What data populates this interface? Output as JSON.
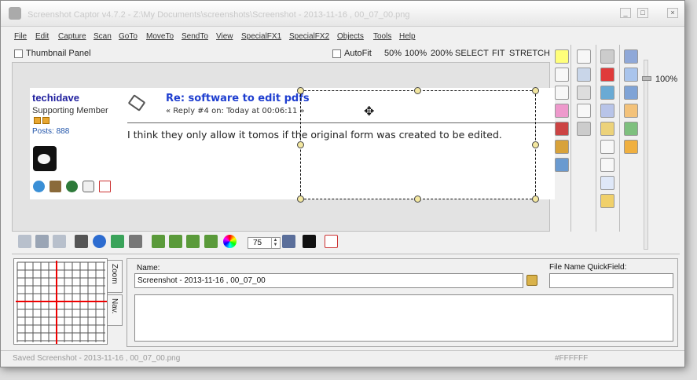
{
  "window": {
    "title": "Screenshot Captor v4.7.2 - Z:\\My Documents\\screenshots\\Screenshot - 2013-11-16 , 00_07_00.png",
    "controls": [
      "_",
      "□",
      "×"
    ]
  },
  "menu": [
    "File",
    "Edit",
    "Capture",
    "Scan",
    "GoTo",
    "MoveTo",
    "SendTo",
    "View",
    "SpecialFX1",
    "SpecialFX2",
    "Objects",
    "Tools",
    "Help"
  ],
  "viewbar": {
    "thumbnail_panel": "Thumbnail Panel",
    "autofit": "AutoFit",
    "zoom_options": [
      "50%",
      "100%",
      "200%",
      "SELECT",
      "FIT",
      "STRETCH"
    ]
  },
  "post": {
    "username": "techidave",
    "role": "Supporting Member",
    "posts": "Posts: 888",
    "subject": "Re: software to edit pdfs",
    "reply_line": "« Reply #4 on: Today at 00:06:11 »",
    "body": "I think they only allow it tomos if the original form was created to be edited."
  },
  "zoom_label": "100%",
  "spin_value": "75",
  "nav_tabs": {
    "zoom": "Zoom",
    "nav": "Nav."
  },
  "info": {
    "name_label": "Name:",
    "name_value": "Screenshot - 2013-11-16 , 00_07_00",
    "quickfield_label": "File Name QuickField:",
    "quickfield_value": ""
  },
  "status": {
    "message": "Saved Screenshot - 2013-11-16 , 00_07_00.png",
    "color": "#FFFFFF"
  },
  "icons": {
    "right_panel": [
      "yellow-square-icon",
      "crop-icon",
      "printer-icon",
      "save-icon",
      "pen-icon",
      "box-icon",
      "toolbox-icon",
      "plus-page-icon",
      "text-icon",
      "screen-icon",
      "edit-icon",
      "brush-icon",
      "grid-icon",
      "link-icon",
      "highlight-icon",
      "shapes-icon",
      "shadow-icon",
      "magic-icon",
      "image-icon",
      "pointer-icon",
      "paste-icon",
      "select-all-icon",
      "resize-icon"
    ],
    "bottom_toolbar": [
      "scan-icon",
      "scan2-icon",
      "scan3-icon",
      "flip-icon",
      "globe-icon",
      "list-icon",
      "mirror-icon",
      "crop-left-icon",
      "crop-right-icon",
      "crop-top-icon",
      "crop-bottom-icon",
      "color-wheel-icon",
      "window-icon",
      "cursor-icon",
      "pdf-icon"
    ]
  }
}
